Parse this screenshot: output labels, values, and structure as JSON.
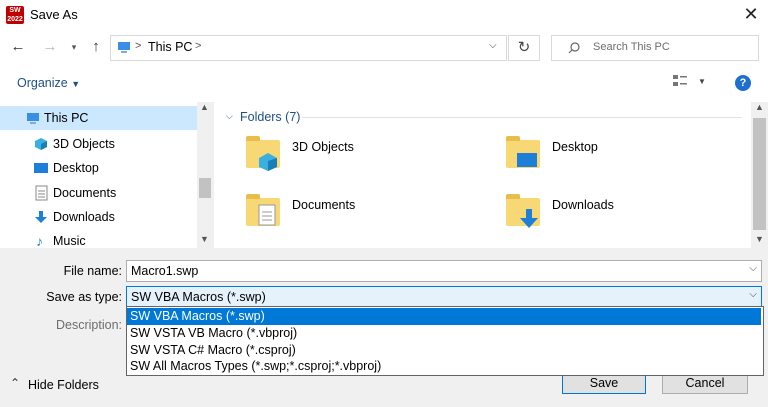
{
  "window": {
    "title": "Save As",
    "app_badge_line1": "SW",
    "app_badge_line2": "2022"
  },
  "nav": {
    "path_segment": "This PC",
    "search_placeholder": "Search This PC"
  },
  "toolbar": {
    "organize_label": "Organize",
    "help_label": "?"
  },
  "sidebar": {
    "items": [
      {
        "label": "This PC",
        "icon": "computer-icon"
      },
      {
        "label": "3D Objects",
        "icon": "3d-cube-icon"
      },
      {
        "label": "Desktop",
        "icon": "desktop-icon"
      },
      {
        "label": "Documents",
        "icon": "document-icon"
      },
      {
        "label": "Downloads",
        "icon": "download-arrow-icon"
      },
      {
        "label": "Music",
        "icon": "music-note-icon"
      }
    ]
  },
  "main": {
    "group_header": "Folders (7)",
    "folders": [
      {
        "label": "3D Objects",
        "icon": "folder-3d-objects-icon"
      },
      {
        "label": "Desktop",
        "icon": "folder-desktop-icon"
      },
      {
        "label": "Documents",
        "icon": "folder-documents-icon"
      },
      {
        "label": "Downloads",
        "icon": "folder-downloads-icon"
      }
    ]
  },
  "form": {
    "filename_label": "File name:",
    "filename_value": "Macro1.swp",
    "savetype_label": "Save as type:",
    "savetype_value": "SW VBA Macros (*.swp)",
    "description_label": "Description:",
    "savetype_options": [
      "SW VBA Macros (*.swp)",
      "SW VSTA VB Macro (*.vbproj)",
      "SW VSTA C# Macro (*.csproj)",
      "SW All Macros Types (*.swp;*.csproj;*.vbproj)"
    ],
    "selected_option_index": 0
  },
  "footer": {
    "hide_folders_label": "Hide Folders",
    "save_label": "Save",
    "cancel_label": "Cancel"
  },
  "colors": {
    "accent": "#0078d7",
    "selection": "#cce8ff",
    "folder": "#f8d775",
    "link_blue": "#1e4e8c"
  }
}
